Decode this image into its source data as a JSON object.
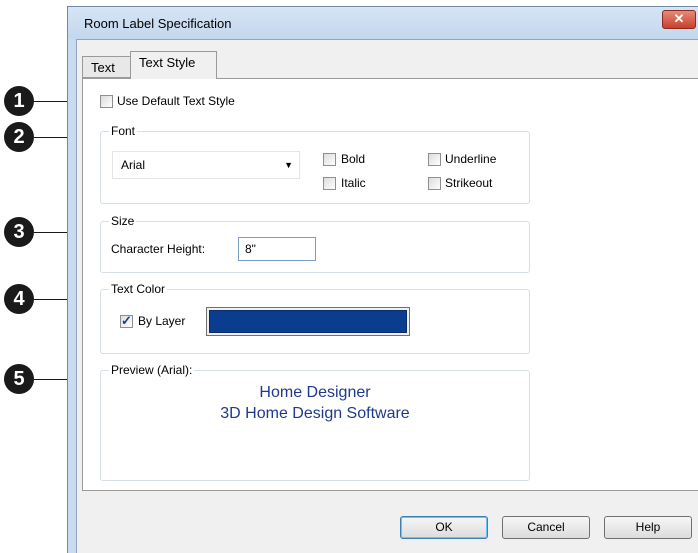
{
  "window": {
    "title": "Room Label Specification",
    "close_glyph": "✕"
  },
  "tabs": [
    {
      "label": "Text",
      "active": false
    },
    {
      "label": "Text Style",
      "active": true
    }
  ],
  "callouts": [
    "1",
    "2",
    "3",
    "4",
    "5"
  ],
  "use_default": {
    "label": "Use Default Text Style",
    "checked": false
  },
  "font_group": {
    "title": "Font",
    "font_value": "Arial",
    "options": [
      {
        "label": "Bold",
        "checked": false
      },
      {
        "label": "Underline",
        "checked": false
      },
      {
        "label": "Italic",
        "checked": false
      },
      {
        "label": "Strikeout",
        "checked": false
      }
    ]
  },
  "size_group": {
    "title": "Size",
    "char_height_label": "Character Height:",
    "char_height_value": "8\""
  },
  "color_group": {
    "title": "Text Color",
    "by_layer_label": "By Layer",
    "by_layer_checked": true,
    "swatch_color": "#0a3d8f"
  },
  "preview_group": {
    "title": "Preview (Arial):",
    "line1": "Home Designer",
    "line2": "3D Home Design Software"
  },
  "buttons": {
    "ok": "OK",
    "cancel": "Cancel",
    "help": "Help"
  }
}
